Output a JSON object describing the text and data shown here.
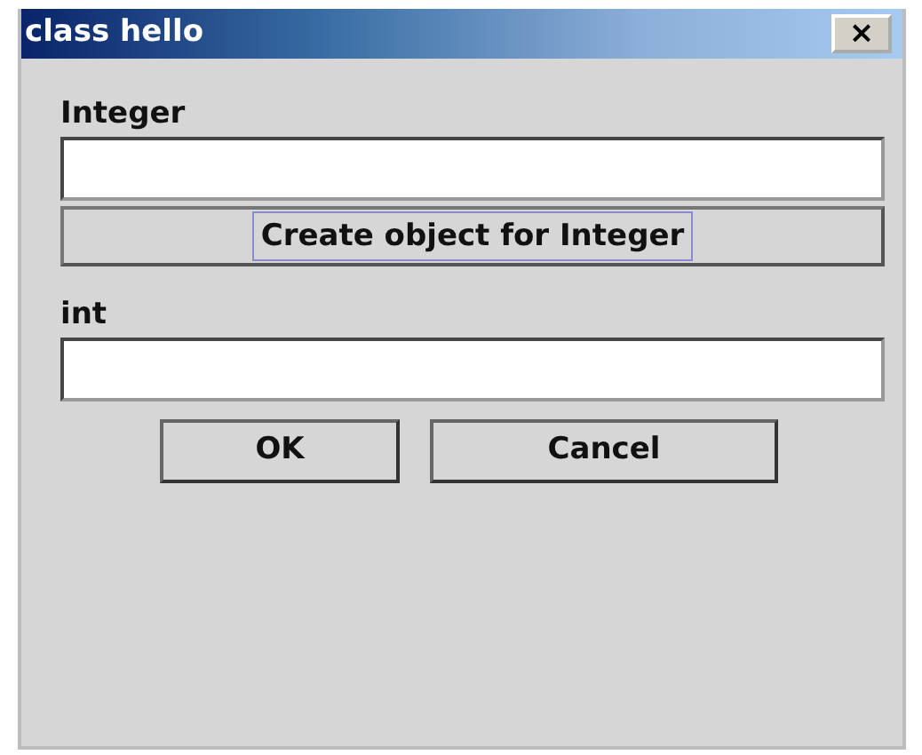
{
  "window": {
    "title": "class hello",
    "close_button": "×"
  },
  "parameters": [
    {
      "label": "Integer",
      "create_button": {
        "label": "Create object for Integer",
        "focused": true
      }
    },
    {
      "label": "int"
    }
  ],
  "buttons": [
    {
      "label": "OK"
    },
    {
      "label": "Cancel"
    }
  ]
}
